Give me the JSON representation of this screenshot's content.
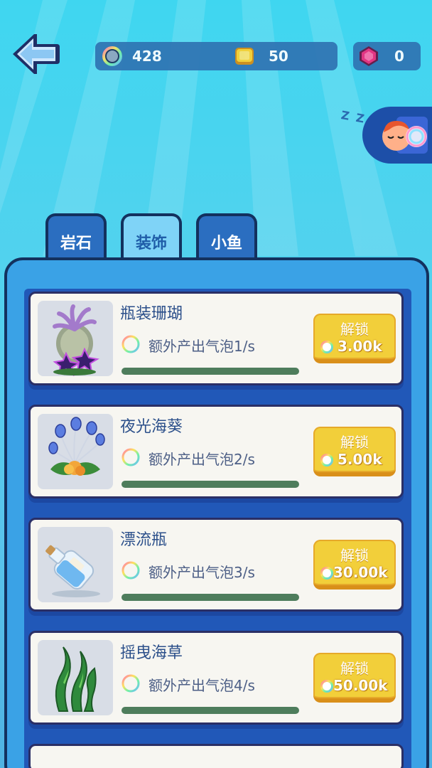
{
  "resources": {
    "bubbles": "428",
    "coins": "50",
    "gems": "0"
  },
  "icons": {
    "back": "back-arrow-icon",
    "bubble": "rainbow-bubble-icon",
    "coin": "gold-coin-icon",
    "gem": "pink-gem-icon",
    "sleep": "sleeping-character-icon"
  },
  "colors": {
    "accent": "#2b6ec0",
    "button": "#f2cf3a",
    "card": "#f7f6f1"
  },
  "sleep_badge": "Z Z",
  "tabs": [
    {
      "label": "岩石",
      "active": false
    },
    {
      "label": "装饰",
      "active": true
    },
    {
      "label": "小鱼",
      "active": false
    }
  ],
  "items": [
    {
      "name": "瓶装珊瑚",
      "desc": "额外产出气泡1/s",
      "unlock_label": "解锁",
      "cost": "3.00k"
    },
    {
      "name": "夜光海葵",
      "desc": "额外产出气泡2/s",
      "unlock_label": "解锁",
      "cost": "5.00k"
    },
    {
      "name": "漂流瓶",
      "desc": "额外产出气泡3/s",
      "unlock_label": "解锁",
      "cost": "30.00k"
    },
    {
      "name": "摇曳海草",
      "desc": "额外产出气泡4/s",
      "unlock_label": "解锁",
      "cost": "50.00k"
    }
  ]
}
